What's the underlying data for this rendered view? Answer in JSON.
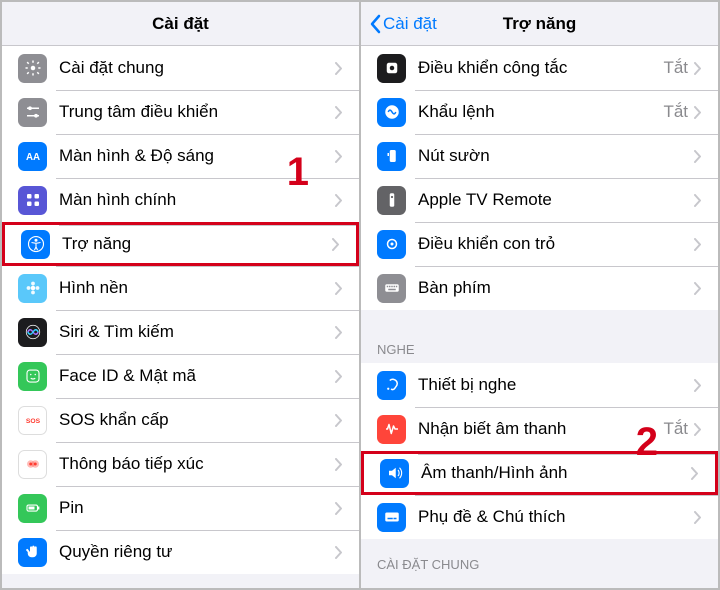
{
  "annotations": {
    "step1": "1",
    "step2": "2"
  },
  "left": {
    "title": "Cài đặt",
    "rows": [
      {
        "label": "Cài đặt chung",
        "iconClass": "bg-gray",
        "iconName": "gear-icon",
        "glyph": "gear"
      },
      {
        "label": "Trung tâm điều khiển",
        "iconClass": "bg-gray",
        "iconName": "control-center-icon",
        "glyph": "sliders"
      },
      {
        "label": "Màn hình & Độ sáng",
        "iconClass": "bg-blue",
        "iconName": "aa-icon",
        "glyph": "aa"
      },
      {
        "label": "Màn hình chính",
        "iconClass": "bg-purple",
        "iconName": "home-screen-icon",
        "glyph": "grid"
      },
      {
        "label": "Trợ năng",
        "iconClass": "bg-blue",
        "iconName": "accessibility-icon",
        "glyph": "accessibility",
        "highlighted": true
      },
      {
        "label": "Hình nền",
        "iconClass": "bg-teal",
        "iconName": "wallpaper-icon",
        "glyph": "flower"
      },
      {
        "label": "Siri & Tìm kiếm",
        "iconClass": "bg-black",
        "iconName": "siri-icon",
        "glyph": "siri"
      },
      {
        "label": "Face ID & Mật mã",
        "iconClass": "bg-green",
        "iconName": "faceid-icon",
        "glyph": "face"
      },
      {
        "label": "SOS khẩn cấp",
        "iconClass": "bg-white",
        "iconName": "sos-icon",
        "glyph": "sos"
      },
      {
        "label": "Thông báo tiếp xúc",
        "iconClass": "bg-white",
        "iconName": "exposure-icon",
        "glyph": "exposure"
      },
      {
        "label": "Pin",
        "iconClass": "bg-green",
        "iconName": "battery-icon",
        "glyph": "battery"
      },
      {
        "label": "Quyền riêng tư",
        "iconClass": "bg-blue",
        "iconName": "privacy-icon",
        "glyph": "hand"
      }
    ]
  },
  "right": {
    "title": "Trợ năng",
    "back": "Cài đặt",
    "group1": [
      {
        "label": "Điều khiển công tắc",
        "value": "Tắt",
        "iconClass": "bg-black",
        "iconName": "switch-control-icon",
        "glyph": "switch"
      },
      {
        "label": "Khẩu lệnh",
        "value": "Tắt",
        "iconClass": "bg-blue",
        "iconName": "voice-control-icon",
        "glyph": "voice"
      },
      {
        "label": "Nút sườn",
        "iconClass": "bg-blue",
        "iconName": "side-button-icon",
        "glyph": "sidebutton"
      },
      {
        "label": "Apple TV Remote",
        "iconClass": "bg-darkgray",
        "iconName": "remote-icon",
        "glyph": "remote"
      },
      {
        "label": "Điều khiển con trỏ",
        "iconClass": "bg-blue",
        "iconName": "pointer-icon",
        "glyph": "pointer"
      },
      {
        "label": "Bàn phím",
        "iconClass": "bg-gray",
        "iconName": "keyboard-icon",
        "glyph": "keyboard"
      }
    ],
    "group2_header": "NGHE",
    "group2": [
      {
        "label": "Thiết bị nghe",
        "iconClass": "bg-blue",
        "iconName": "hearing-devices-icon",
        "glyph": "ear"
      },
      {
        "label": "Nhận biết âm thanh",
        "value": "Tắt",
        "iconClass": "bg-orange",
        "iconName": "sound-recognition-icon",
        "glyph": "soundwave"
      },
      {
        "label": "Âm thanh/Hình ảnh",
        "iconClass": "bg-blue",
        "iconName": "audio-visual-icon",
        "glyph": "speaker",
        "highlighted": true
      },
      {
        "label": "Phụ đề & Chú thích",
        "iconClass": "bg-blue",
        "iconName": "subtitles-icon",
        "glyph": "subtitle"
      }
    ],
    "group3_header": "CÀI ĐẶT CHUNG"
  }
}
